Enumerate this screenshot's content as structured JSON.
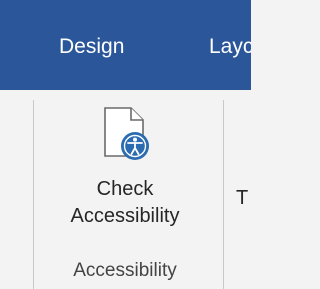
{
  "tabs": [
    {
      "label": "Design"
    },
    {
      "label": "Layc"
    }
  ],
  "ribbon": {
    "check_button": {
      "line1": "Check",
      "line2": "Accessibility",
      "icon": "document-accessibility-icon"
    },
    "group_label": "Accessibility",
    "partial_next_label": "T"
  },
  "colors": {
    "tab_bar": "#2b579a",
    "ribbon_bg": "#f3f3f3",
    "icon_accent": "#2b6cb0",
    "separator": "#c8c8c8"
  }
}
